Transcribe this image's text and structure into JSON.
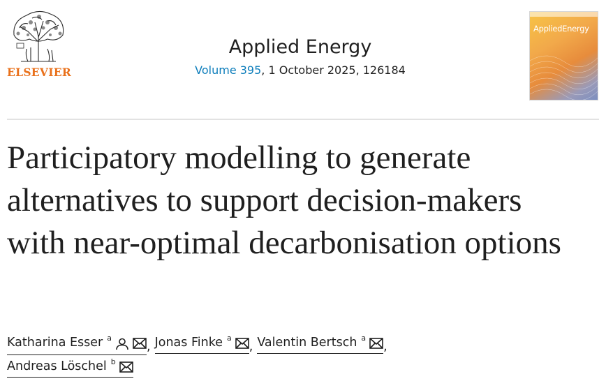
{
  "header": {
    "publisher": "ELSEVIER",
    "journal_title": "Applied Energy",
    "volume_label": "Volume 395",
    "issue_rest": ", 1 October 2025, 126184"
  },
  "cover": {
    "title": "AppliedEnergy",
    "brand_colors": [
      "#f7c446",
      "#e78c3c",
      "#7c8fc0"
    ]
  },
  "article": {
    "title": "Participatory modelling to generate alternatives to support decision-makers with near-optimal decarbonisation options"
  },
  "authors": [
    {
      "name": "Katharina Esser",
      "aff": "a",
      "icons": [
        "person-icon",
        "envelope-icon"
      ]
    },
    {
      "name": "Jonas Finke",
      "aff": "a",
      "icons": [
        "envelope-icon"
      ]
    },
    {
      "name": "Valentin Bertsch",
      "aff": "a",
      "icons": [
        "envelope-icon"
      ]
    },
    {
      "name": "Andreas Löschel",
      "aff": "b",
      "icons": [
        "envelope-icon"
      ]
    }
  ],
  "separator": ",",
  "colors": {
    "link": "#0c7dbb",
    "publisher_orange": "#e9711c",
    "text": "#1f1f1f"
  }
}
